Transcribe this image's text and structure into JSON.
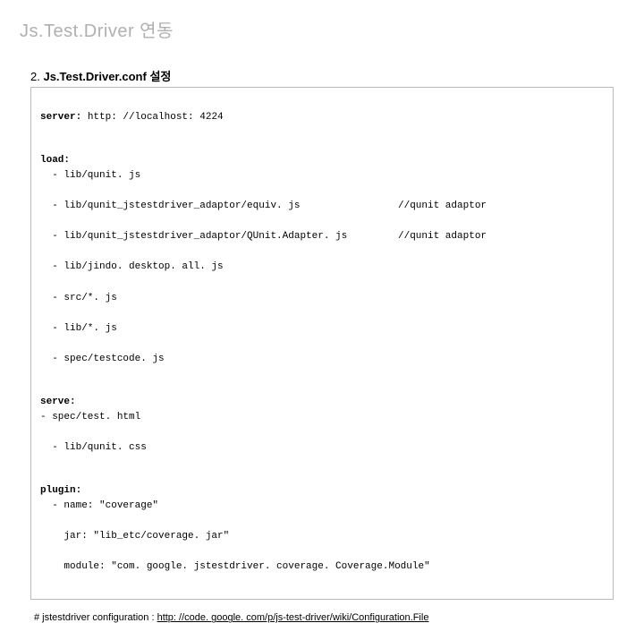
{
  "title": "Js.Test.Driver 연동",
  "section": {
    "number": "2.",
    "label": "Js.Test.Driver.conf 설정"
  },
  "config": {
    "server_key": "server:",
    "server_val": " http: //localhost: 4224",
    "load_key": "load:",
    "load_items": [
      {
        "path": "  - lib/qunit. js",
        "comment": ""
      },
      {
        "path": "  - lib/qunit_jstestdriver_adaptor/equiv. js",
        "comment": "//qunit adaptor"
      },
      {
        "path": "  - lib/qunit_jstestdriver_adaptor/QUnit.Adapter. js",
        "comment": "//qunit adaptor"
      },
      {
        "path": "  - lib/jindo. desktop. all. js",
        "comment": ""
      },
      {
        "path": "  - src/*. js",
        "comment": ""
      },
      {
        "path": "  - lib/*. js",
        "comment": ""
      },
      {
        "path": "  - spec/testcode. js",
        "comment": ""
      }
    ],
    "serve_key": "serve:",
    "serve_items": [
      "- spec/test. html",
      "  - lib/qunit. css"
    ],
    "plugin_key": "plugin:",
    "plugin_lines": [
      "  - name: \"coverage\"",
      "    jar: \"lib_etc/coverage. jar\"",
      "    module: \"com. google. jstestdriver. coverage. Coverage.Module\""
    ]
  },
  "footnote": {
    "prefix": "# jstestdriver configuration : ",
    "link_text": "http: //code. google. com/p/js-test-driver/wiki/Configuration.File"
  }
}
